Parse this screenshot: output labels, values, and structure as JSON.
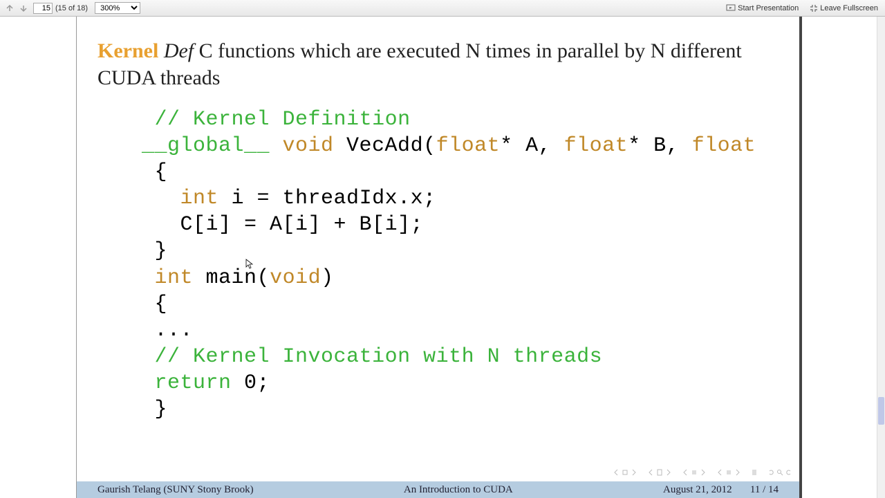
{
  "toolbar": {
    "page_current": "15",
    "page_total": "(15 of 18)",
    "zoom": "300%",
    "start_presentation": "Start Presentation",
    "leave_fullscreen": "Leave Fullscreen"
  },
  "slide": {
    "kernel": "Kernel",
    "def": "Def",
    "def_text": " C functions which are executed N times in parallel by N different CUDA threads",
    "code": {
      "c1": "// Kernel Definition",
      "l2a": "__global__",
      "l2b": " void",
      "l2c": " VecAdd(",
      "l2d": "float",
      "l2e": "* A, ",
      "l2f": "float",
      "l2g": "* B, ",
      "l2h": "float",
      "l3": "{",
      "l4a": "int",
      "l4b": " i = threadIdx.x;",
      "l5": "C[i] = A[i] + B[i];",
      "l6": "}",
      "l7a": "int",
      "l7b": " main(",
      "l7c": "void",
      "l7d": ")",
      "l8": "{",
      "l9": "...",
      "c2": "// Kernel Invocation with N threads",
      "l11a": "return",
      "l11b": " 0;",
      "l12": "}"
    }
  },
  "footer": {
    "author": "Gaurish Telang  (SUNY Stony Brook)",
    "title": "An Introduction to CUDA",
    "date": "August 21, 2012",
    "page": "11 / 14"
  }
}
